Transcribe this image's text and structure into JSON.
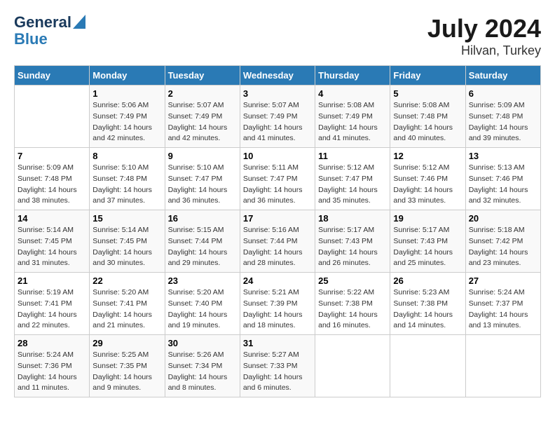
{
  "logo": {
    "line1": "General",
    "line2": "Blue"
  },
  "title": {
    "month_year": "July 2024",
    "location": "Hilvan, Turkey"
  },
  "header": {
    "days": [
      "Sunday",
      "Monday",
      "Tuesday",
      "Wednesday",
      "Thursday",
      "Friday",
      "Saturday"
    ]
  },
  "weeks": [
    [
      {
        "num": "",
        "sunrise": "",
        "sunset": "",
        "daylight": ""
      },
      {
        "num": "1",
        "sunrise": "Sunrise: 5:06 AM",
        "sunset": "Sunset: 7:49 PM",
        "daylight": "Daylight: 14 hours and 42 minutes."
      },
      {
        "num": "2",
        "sunrise": "Sunrise: 5:07 AM",
        "sunset": "Sunset: 7:49 PM",
        "daylight": "Daylight: 14 hours and 42 minutes."
      },
      {
        "num": "3",
        "sunrise": "Sunrise: 5:07 AM",
        "sunset": "Sunset: 7:49 PM",
        "daylight": "Daylight: 14 hours and 41 minutes."
      },
      {
        "num": "4",
        "sunrise": "Sunrise: 5:08 AM",
        "sunset": "Sunset: 7:49 PM",
        "daylight": "Daylight: 14 hours and 41 minutes."
      },
      {
        "num": "5",
        "sunrise": "Sunrise: 5:08 AM",
        "sunset": "Sunset: 7:48 PM",
        "daylight": "Daylight: 14 hours and 40 minutes."
      },
      {
        "num": "6",
        "sunrise": "Sunrise: 5:09 AM",
        "sunset": "Sunset: 7:48 PM",
        "daylight": "Daylight: 14 hours and 39 minutes."
      }
    ],
    [
      {
        "num": "7",
        "sunrise": "Sunrise: 5:09 AM",
        "sunset": "Sunset: 7:48 PM",
        "daylight": "Daylight: 14 hours and 38 minutes."
      },
      {
        "num": "8",
        "sunrise": "Sunrise: 5:10 AM",
        "sunset": "Sunset: 7:48 PM",
        "daylight": "Daylight: 14 hours and 37 minutes."
      },
      {
        "num": "9",
        "sunrise": "Sunrise: 5:10 AM",
        "sunset": "Sunset: 7:47 PM",
        "daylight": "Daylight: 14 hours and 36 minutes."
      },
      {
        "num": "10",
        "sunrise": "Sunrise: 5:11 AM",
        "sunset": "Sunset: 7:47 PM",
        "daylight": "Daylight: 14 hours and 36 minutes."
      },
      {
        "num": "11",
        "sunrise": "Sunrise: 5:12 AM",
        "sunset": "Sunset: 7:47 PM",
        "daylight": "Daylight: 14 hours and 35 minutes."
      },
      {
        "num": "12",
        "sunrise": "Sunrise: 5:12 AM",
        "sunset": "Sunset: 7:46 PM",
        "daylight": "Daylight: 14 hours and 33 minutes."
      },
      {
        "num": "13",
        "sunrise": "Sunrise: 5:13 AM",
        "sunset": "Sunset: 7:46 PM",
        "daylight": "Daylight: 14 hours and 32 minutes."
      }
    ],
    [
      {
        "num": "14",
        "sunrise": "Sunrise: 5:14 AM",
        "sunset": "Sunset: 7:45 PM",
        "daylight": "Daylight: 14 hours and 31 minutes."
      },
      {
        "num": "15",
        "sunrise": "Sunrise: 5:14 AM",
        "sunset": "Sunset: 7:45 PM",
        "daylight": "Daylight: 14 hours and 30 minutes."
      },
      {
        "num": "16",
        "sunrise": "Sunrise: 5:15 AM",
        "sunset": "Sunset: 7:44 PM",
        "daylight": "Daylight: 14 hours and 29 minutes."
      },
      {
        "num": "17",
        "sunrise": "Sunrise: 5:16 AM",
        "sunset": "Sunset: 7:44 PM",
        "daylight": "Daylight: 14 hours and 28 minutes."
      },
      {
        "num": "18",
        "sunrise": "Sunrise: 5:17 AM",
        "sunset": "Sunset: 7:43 PM",
        "daylight": "Daylight: 14 hours and 26 minutes."
      },
      {
        "num": "19",
        "sunrise": "Sunrise: 5:17 AM",
        "sunset": "Sunset: 7:43 PM",
        "daylight": "Daylight: 14 hours and 25 minutes."
      },
      {
        "num": "20",
        "sunrise": "Sunrise: 5:18 AM",
        "sunset": "Sunset: 7:42 PM",
        "daylight": "Daylight: 14 hours and 23 minutes."
      }
    ],
    [
      {
        "num": "21",
        "sunrise": "Sunrise: 5:19 AM",
        "sunset": "Sunset: 7:41 PM",
        "daylight": "Daylight: 14 hours and 22 minutes."
      },
      {
        "num": "22",
        "sunrise": "Sunrise: 5:20 AM",
        "sunset": "Sunset: 7:41 PM",
        "daylight": "Daylight: 14 hours and 21 minutes."
      },
      {
        "num": "23",
        "sunrise": "Sunrise: 5:20 AM",
        "sunset": "Sunset: 7:40 PM",
        "daylight": "Daylight: 14 hours and 19 minutes."
      },
      {
        "num": "24",
        "sunrise": "Sunrise: 5:21 AM",
        "sunset": "Sunset: 7:39 PM",
        "daylight": "Daylight: 14 hours and 18 minutes."
      },
      {
        "num": "25",
        "sunrise": "Sunrise: 5:22 AM",
        "sunset": "Sunset: 7:38 PM",
        "daylight": "Daylight: 14 hours and 16 minutes."
      },
      {
        "num": "26",
        "sunrise": "Sunrise: 5:23 AM",
        "sunset": "Sunset: 7:38 PM",
        "daylight": "Daylight: 14 hours and 14 minutes."
      },
      {
        "num": "27",
        "sunrise": "Sunrise: 5:24 AM",
        "sunset": "Sunset: 7:37 PM",
        "daylight": "Daylight: 14 hours and 13 minutes."
      }
    ],
    [
      {
        "num": "28",
        "sunrise": "Sunrise: 5:24 AM",
        "sunset": "Sunset: 7:36 PM",
        "daylight": "Daylight: 14 hours and 11 minutes."
      },
      {
        "num": "29",
        "sunrise": "Sunrise: 5:25 AM",
        "sunset": "Sunset: 7:35 PM",
        "daylight": "Daylight: 14 hours and 9 minutes."
      },
      {
        "num": "30",
        "sunrise": "Sunrise: 5:26 AM",
        "sunset": "Sunset: 7:34 PM",
        "daylight": "Daylight: 14 hours and 8 minutes."
      },
      {
        "num": "31",
        "sunrise": "Sunrise: 5:27 AM",
        "sunset": "Sunset: 7:33 PM",
        "daylight": "Daylight: 14 hours and 6 minutes."
      },
      {
        "num": "",
        "sunrise": "",
        "sunset": "",
        "daylight": ""
      },
      {
        "num": "",
        "sunrise": "",
        "sunset": "",
        "daylight": ""
      },
      {
        "num": "",
        "sunrise": "",
        "sunset": "",
        "daylight": ""
      }
    ]
  ]
}
